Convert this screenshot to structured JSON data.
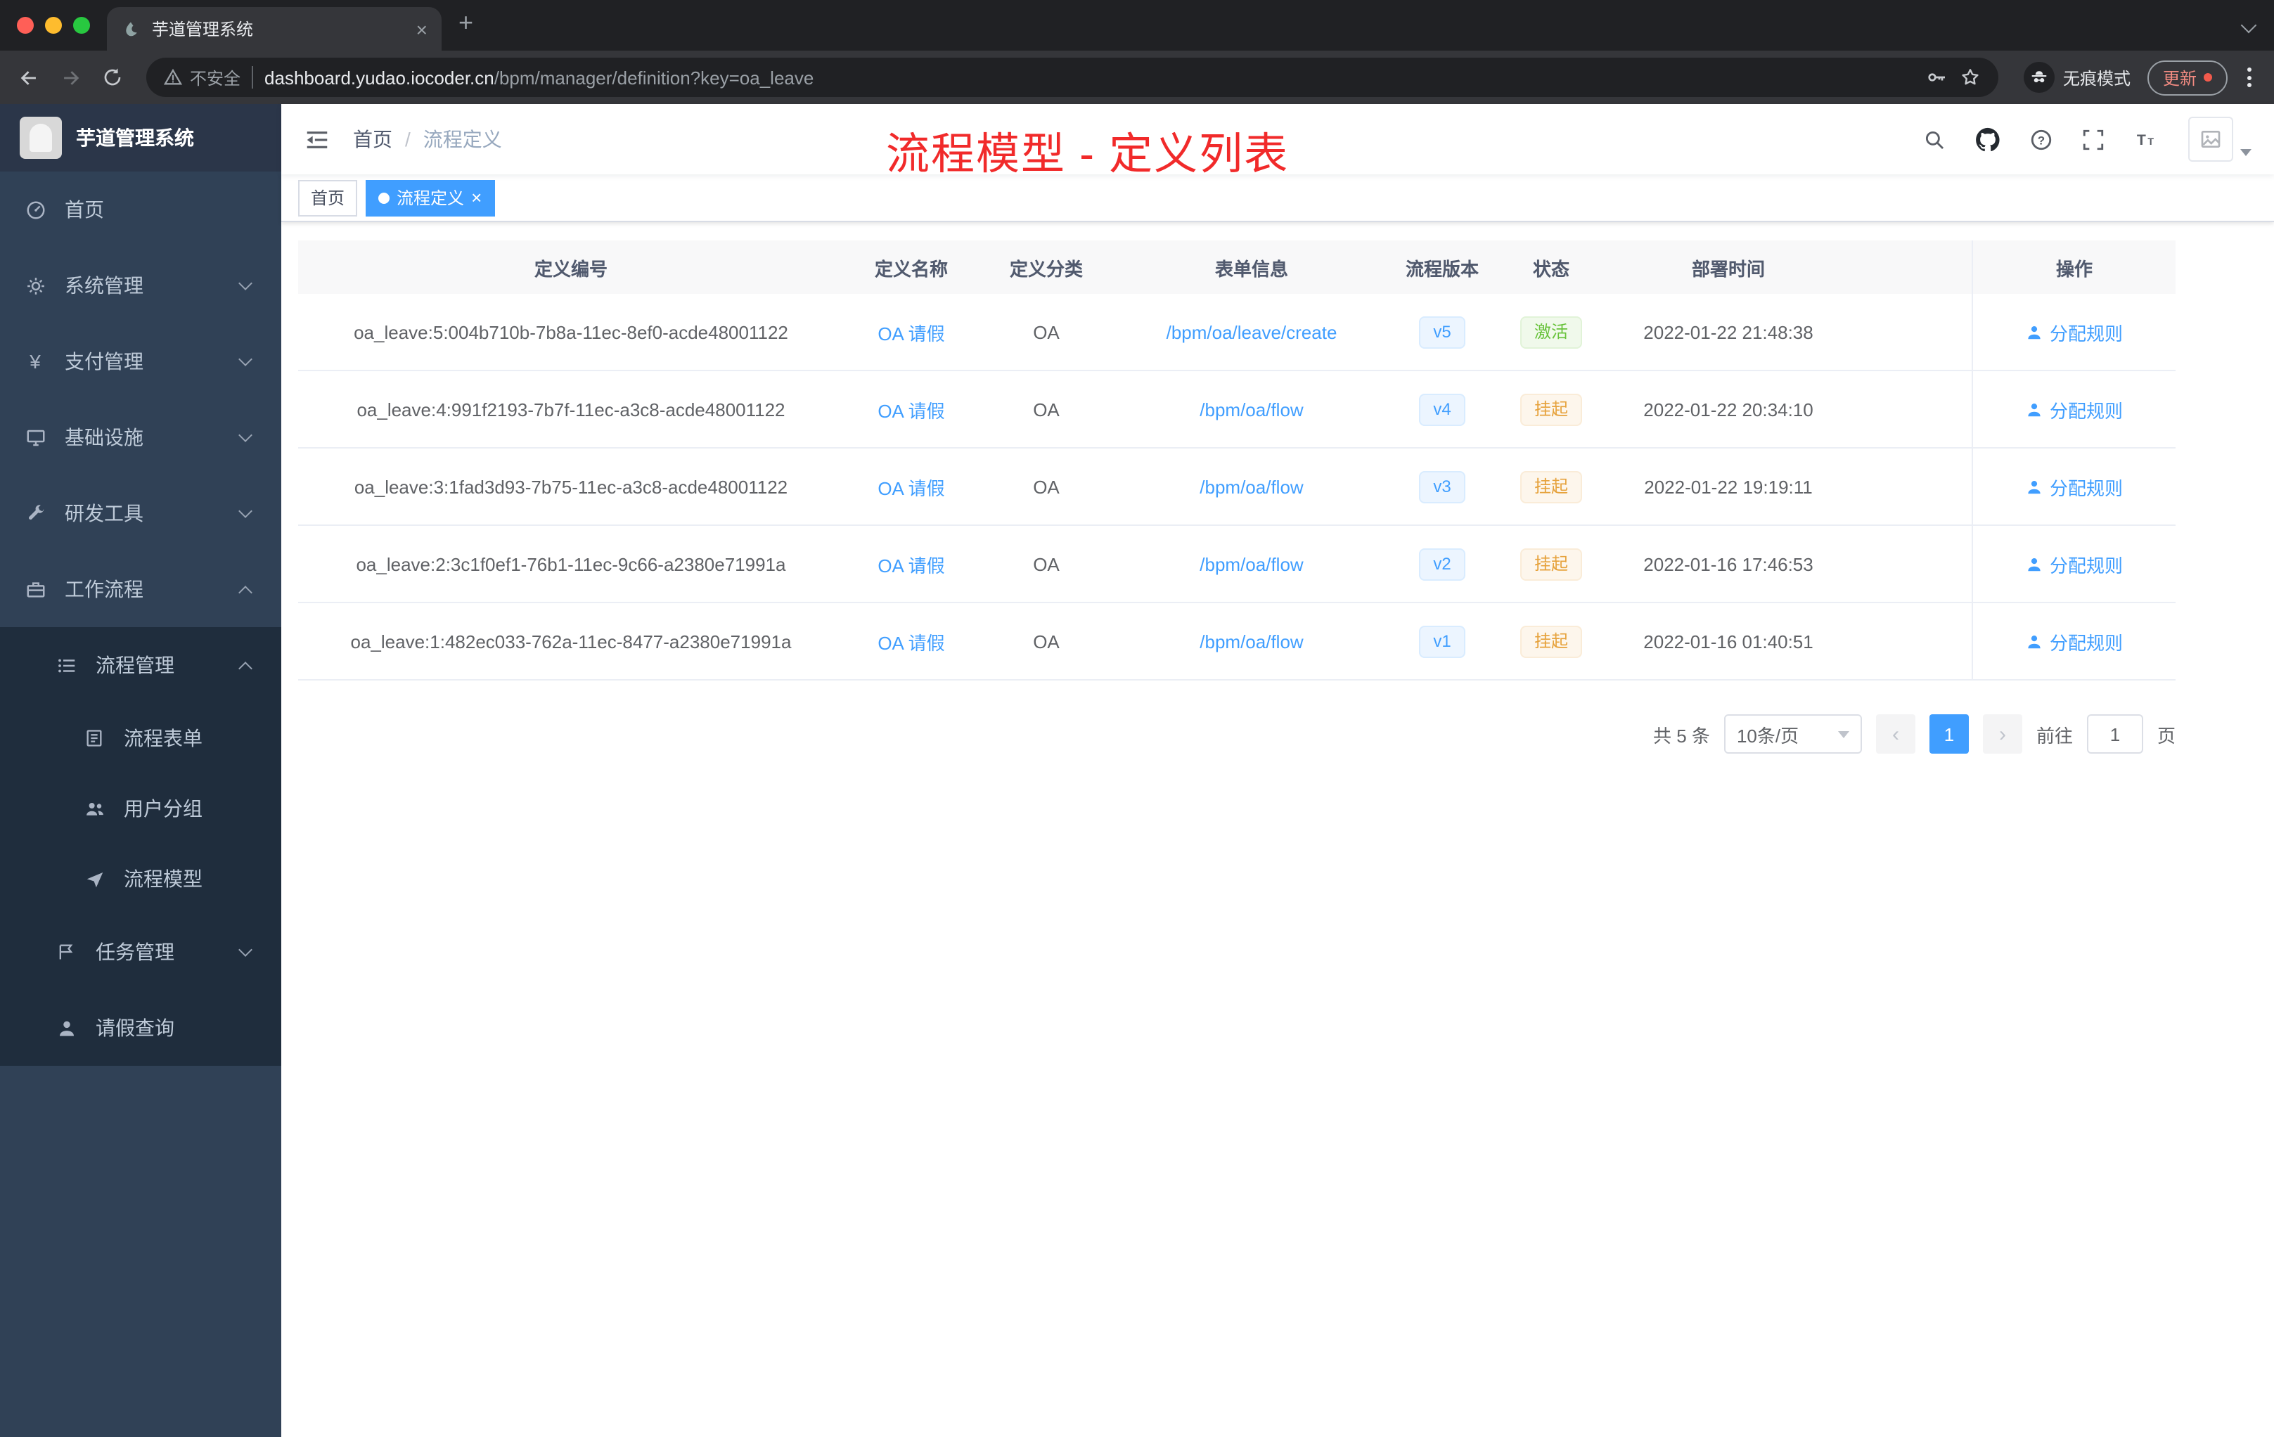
{
  "colors": {
    "accent": "#409eff",
    "success": "#67c23a",
    "warning": "#e6a23c",
    "annotation_red": "#f12a2a",
    "sidebar_bg": "#304156"
  },
  "browser": {
    "tab": {
      "title": "芋道管理系统",
      "close": "×",
      "new_tab": "+"
    },
    "toolbar": {
      "security_label": "不安全",
      "url_domain": "dashboard.yudao.iocoder.cn",
      "url_path": "/bpm/manager/definition?key=oa_leave",
      "incognito_label": "无痕模式",
      "update_label": "更新"
    }
  },
  "icons": {
    "payment_symbol": "¥",
    "question_mark": "?"
  },
  "sidebar": {
    "logo_title": "芋道管理系统",
    "items": [
      {
        "label": "首页"
      },
      {
        "label": "系统管理"
      },
      {
        "label": "支付管理"
      },
      {
        "label": "基础设施"
      },
      {
        "label": "研发工具"
      },
      {
        "label": "工作流程"
      },
      {
        "label": "流程管理"
      },
      {
        "label": "流程表单"
      },
      {
        "label": "用户分组"
      },
      {
        "label": "流程模型"
      },
      {
        "label": "任务管理"
      },
      {
        "label": "请假查询"
      }
    ]
  },
  "navbar": {
    "breadcrumb_home": "首页",
    "breadcrumb_sep": "/",
    "breadcrumb_current": "流程定义",
    "annotation": "流程模型 - 定义列表"
  },
  "tags": {
    "home": "首页",
    "active": "流程定义",
    "close": "×"
  },
  "table": {
    "columns": [
      "定义编号",
      "定义名称",
      "定义分类",
      "表单信息",
      "流程版本",
      "状态",
      "部署时间",
      "操作"
    ],
    "rows": [
      {
        "id": "oa_leave:5:004b710b-7b8a-11ec-8ef0-acde48001122",
        "name": "OA 请假",
        "category": "OA",
        "form": "/bpm/oa/leave/create",
        "version": "v5",
        "status": "激活",
        "status_type": "success",
        "time": "2022-01-22 21:48:38",
        "action": "分配规则"
      },
      {
        "id": "oa_leave:4:991f2193-7b7f-11ec-a3c8-acde48001122",
        "name": "OA 请假",
        "category": "OA",
        "form": "/bpm/oa/flow",
        "version": "v4",
        "status": "挂起",
        "status_type": "warning",
        "time": "2022-01-22 20:34:10",
        "action": "分配规则"
      },
      {
        "id": "oa_leave:3:1fad3d93-7b75-11ec-a3c8-acde48001122",
        "name": "OA 请假",
        "category": "OA",
        "form": "/bpm/oa/flow",
        "version": "v3",
        "status": "挂起",
        "status_type": "warning",
        "time": "2022-01-22 19:19:11",
        "action": "分配规则"
      },
      {
        "id": "oa_leave:2:3c1f0ef1-76b1-11ec-9c66-a2380e71991a",
        "name": "OA 请假",
        "category": "OA",
        "form": "/bpm/oa/flow",
        "version": "v2",
        "status": "挂起",
        "status_type": "warning",
        "time": "2022-01-16 17:46:53",
        "action": "分配规则"
      },
      {
        "id": "oa_leave:1:482ec033-762a-11ec-8477-a2380e71991a",
        "name": "OA 请假",
        "category": "OA",
        "form": "/bpm/oa/flow",
        "version": "v1",
        "status": "挂起",
        "status_type": "warning",
        "time": "2022-01-16 01:40:51",
        "action": "分配规则"
      }
    ]
  },
  "pagination": {
    "total_label": "共 5 条",
    "page_size": "10条/页",
    "prev": "‹",
    "next": "›",
    "current_page": "1",
    "goto_label": "前往",
    "goto_value": "1",
    "page_unit": "页"
  }
}
